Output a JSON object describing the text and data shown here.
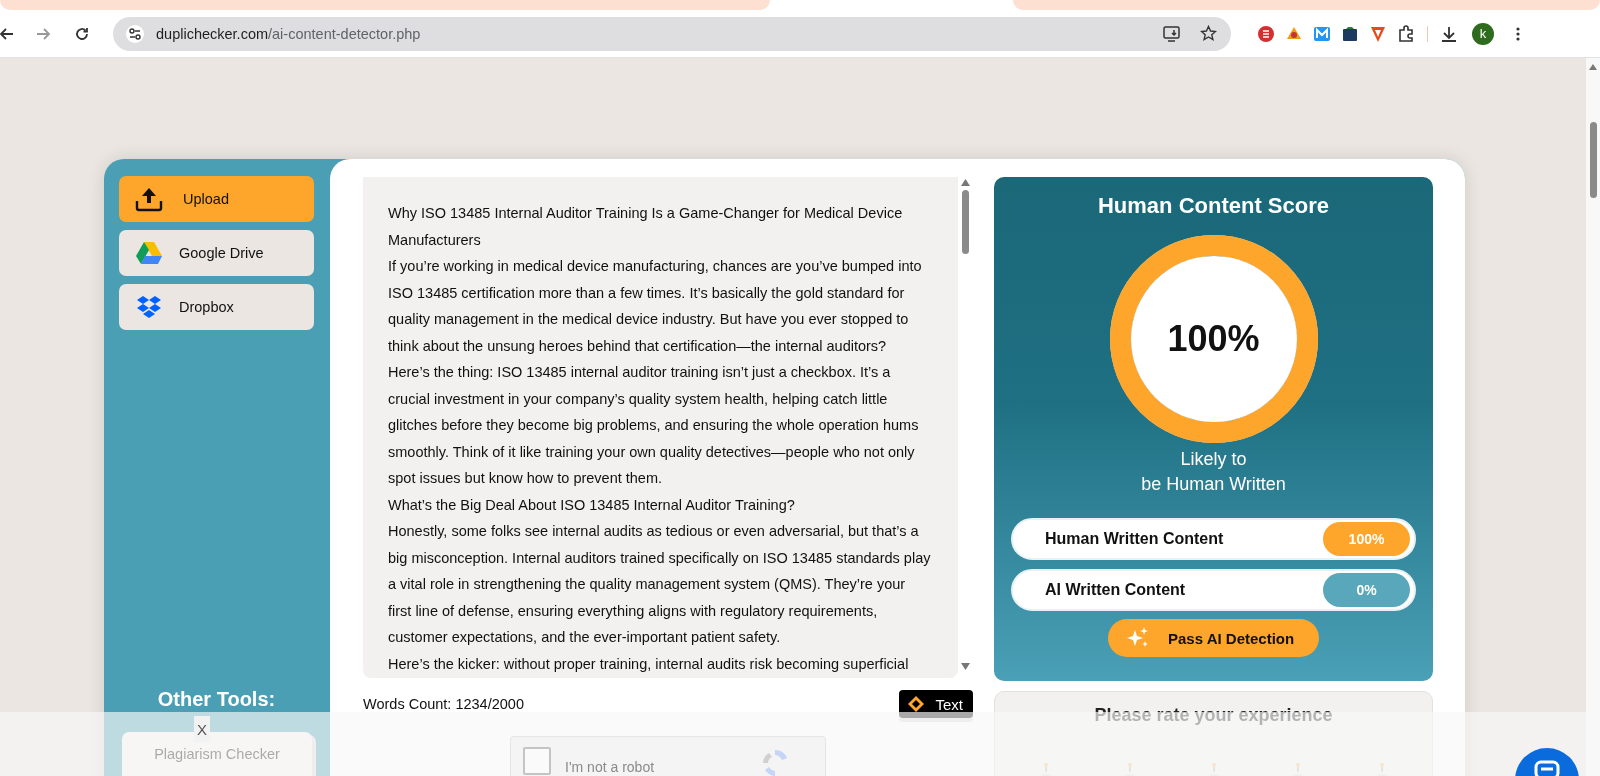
{
  "browser": {
    "url": {
      "host": "duplichecker.com",
      "path": "/ai-content-detector.php"
    },
    "profile": "k"
  },
  "sources": [
    {
      "label": "Upload",
      "kind": "upload",
      "selected": true
    },
    {
      "label": "Google Drive",
      "kind": "drive",
      "selected": false
    },
    {
      "label": "Dropbox",
      "kind": "dropbox",
      "selected": false
    }
  ],
  "other_tools": {
    "title": "Other Tools:",
    "items": [
      "Plagiarism Checker"
    ]
  },
  "editor": {
    "paragraphs": [
      "Why ISO 13485 Internal Auditor Training Is a Game-Changer for Medical Device Manufacturers",
      "If you’re working in medical device manufacturing, chances are you’ve bumped into ISO 13485 certification more than a few times. It’s basically the gold standard for quality management in the medical device industry. But have you ever stopped to think about the unsung heroes behind that certification—the internal auditors?",
      "Here’s the thing: ISO 13485 internal auditor training isn’t just a checkbox. It’s a crucial investment in your company’s quality system health, helping catch little glitches before they become big problems, and ensuring the whole operation hums smoothly. Think of it like training your own quality detectives—people who not only spot issues but know how to prevent them.",
      "What’s the Big Deal About ISO 13485 Internal Auditor Training?",
      "Honestly, some folks see internal audits as tedious or even adversarial, but that’s a big misconception. Internal auditors trained specifically on ISO 13485 standards play a vital role in strengthening the quality management system (QMS). They’re your first line of defense, ensuring everything aligns with regulatory requirements, customer expectations, and the ever-important patient safety.",
      "Here’s the kicker: without proper training, internal audits risk becoming superficial"
    ],
    "words_count": "Words Count: 1234/2000",
    "mode_button": "Text"
  },
  "score": {
    "title": "Human Content Score",
    "value": "100%",
    "level": 1,
    "verdict": [
      "Likely to",
      "be Human Written"
    ],
    "rows": [
      {
        "label": "Human Written Content",
        "value": "100%",
        "kind": "human"
      },
      {
        "label": "AI Written Content",
        "value": "0%",
        "kind": "ai"
      }
    ],
    "action": "Pass AI Detection"
  },
  "rating": {
    "title": "Please rate your experience"
  },
  "overlay": {
    "close": "X",
    "captcha": "I'm not a robot",
    "checked": false
  }
}
